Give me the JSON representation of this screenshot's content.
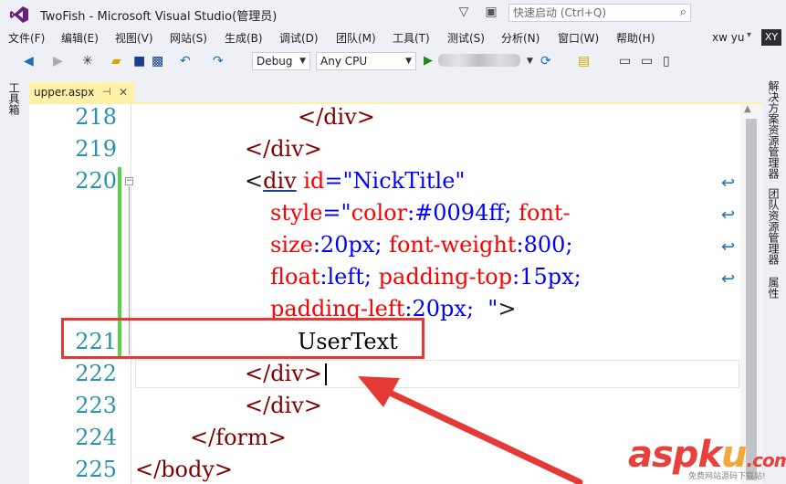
{
  "window": {
    "title": "TwoFish - Microsoft Visual Studio(管理员)",
    "quick_launch_placeholder": "快速启动 (Ctrl+Q)",
    "user_name": "xw yu",
    "avatar_initials": "XY",
    "accent_color": "#68217a"
  },
  "menu": {
    "items": [
      "文件(F)",
      "编辑(E)",
      "视图(V)",
      "网站(S)",
      "生成(B)",
      "调试(D)",
      "团队(M)",
      "工具(T)",
      "测试(S)",
      "分析(N)",
      "窗口(W)",
      "帮助(H)"
    ]
  },
  "toolbar": {
    "configuration": "Debug",
    "platform": "Any CPU"
  },
  "side_panels": {
    "left": "工具箱",
    "right": [
      "解决方案资源管理器",
      "团队资源管理器",
      "属性"
    ]
  },
  "editor": {
    "tab_label": "upper.aspx",
    "tab_pin_icon": "pin-icon",
    "tab_close_icon": "close-icon",
    "line_numbers": [
      "218",
      "219",
      "220",
      "221",
      "222",
      "223",
      "224",
      "225"
    ],
    "code": {
      "l218": "</div>",
      "l219": "</div>",
      "l220_open": "<",
      "l220_tag": "div",
      "l220_attr": " id",
      "l220_eq": "=",
      "l220_val": "\"NickTitle\"",
      "w1_attr": "style",
      "w1_eq": "=",
      "w1_q": "\"",
      "w1_prop": "color",
      "w1_val": ":#0094ff; ",
      "w1_prop2": "font-",
      "w2_prop": "size",
      "w2_val": ":20px; ",
      "w2_prop2": "font-weight",
      "w2_val2": ":800;",
      "w3_prop": "float",
      "w3_val": ":left; ",
      "w3_prop2": "padding-top",
      "w3_val2": ":15px;",
      "w4_prop": "padding-left",
      "w4_val": ":20px;  \"",
      "w4_close": ">",
      "l221": "UserText",
      "l222": "</div>",
      "l223": "</div>",
      "l224": "</form>",
      "l225": "</body>"
    },
    "annotation_color": "#e53935",
    "changed_line_color": "#57d34c"
  },
  "watermark": {
    "brand_a": "asp",
    "brand_k": "k",
    "brand_u": "u",
    "brand_rest": ".com",
    "tagline": "免费网站源码下载站!"
  }
}
